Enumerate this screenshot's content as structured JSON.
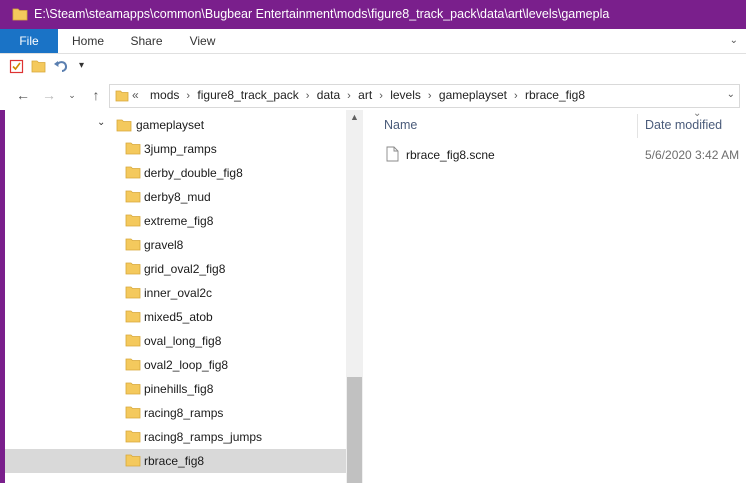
{
  "window": {
    "title": "E:\\Steam\\steamapps\\common\\Bugbear Entertainment\\mods\\figure8_track_pack\\data\\art\\levels\\gamepla"
  },
  "ribbon": {
    "tabs": [
      "File",
      "Home",
      "Share",
      "View"
    ]
  },
  "address": {
    "crumbs": [
      "mods",
      "figure8_track_pack",
      "data",
      "art",
      "levels",
      "gameplayset",
      "rbrace_fig8"
    ],
    "overflow": "«"
  },
  "tree": {
    "parent": "gameplayset",
    "items": [
      "3jump_ramps",
      "derby_double_fig8",
      "derby8_mud",
      "extreme_fig8",
      "gravel8",
      "grid_oval2_fig8",
      "inner_oval2c",
      "mixed5_atob",
      "oval_long_fig8",
      "oval2_loop_fig8",
      "pinehills_fig8",
      "racing8_ramps",
      "racing8_ramps_jumps",
      "rbrace_fig8"
    ],
    "selected": "rbrace_fig8"
  },
  "columns": {
    "name": "Name",
    "date": "Date modified"
  },
  "files": [
    {
      "name": "rbrace_fig8.scne",
      "date": "5/6/2020 3:42 AM"
    }
  ],
  "colors": {
    "titlebar": "#7a1f8c",
    "file_tab": "#1a73c6",
    "selection": "#d9d9d9",
    "folder": "#f4c95d"
  }
}
